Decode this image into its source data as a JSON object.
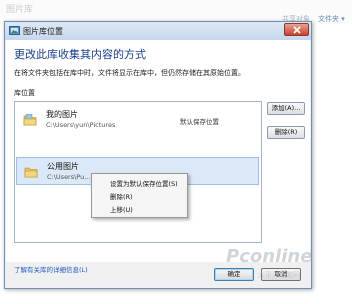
{
  "background": {
    "ghost_title": "图片库",
    "ghost_links": [
      "共享对象",
      "文件夹 ▾"
    ]
  },
  "dialog": {
    "title": "图片库位置",
    "heading": "更改此库收集其内容的方式",
    "description": "在将文件夹包括在库中时，文件将显示在库中，但仍然存储在其原始位置。",
    "section_label": "库位置"
  },
  "locations": [
    {
      "name": "我的图片",
      "path": "C:\\Users\\yun\\Pictures",
      "default_label": "默认保存位置",
      "selected": false
    },
    {
      "name": "公用图片",
      "path": "C:\\Users\\Pu...",
      "default_label": "",
      "selected": true
    }
  ],
  "side_buttons": {
    "add": "添加(A)...",
    "remove": "删除(R)"
  },
  "context_menu": [
    "设置为默认保存位置(S)",
    "删除(R)",
    "上移(U)"
  ],
  "help_link": "了解有关库的详细信息(L)",
  "footer_buttons": {
    "ok": "确定",
    "cancel": "取消"
  },
  "watermark": {
    "logo": "Pconline",
    "sub": "太平洋电脑网"
  }
}
